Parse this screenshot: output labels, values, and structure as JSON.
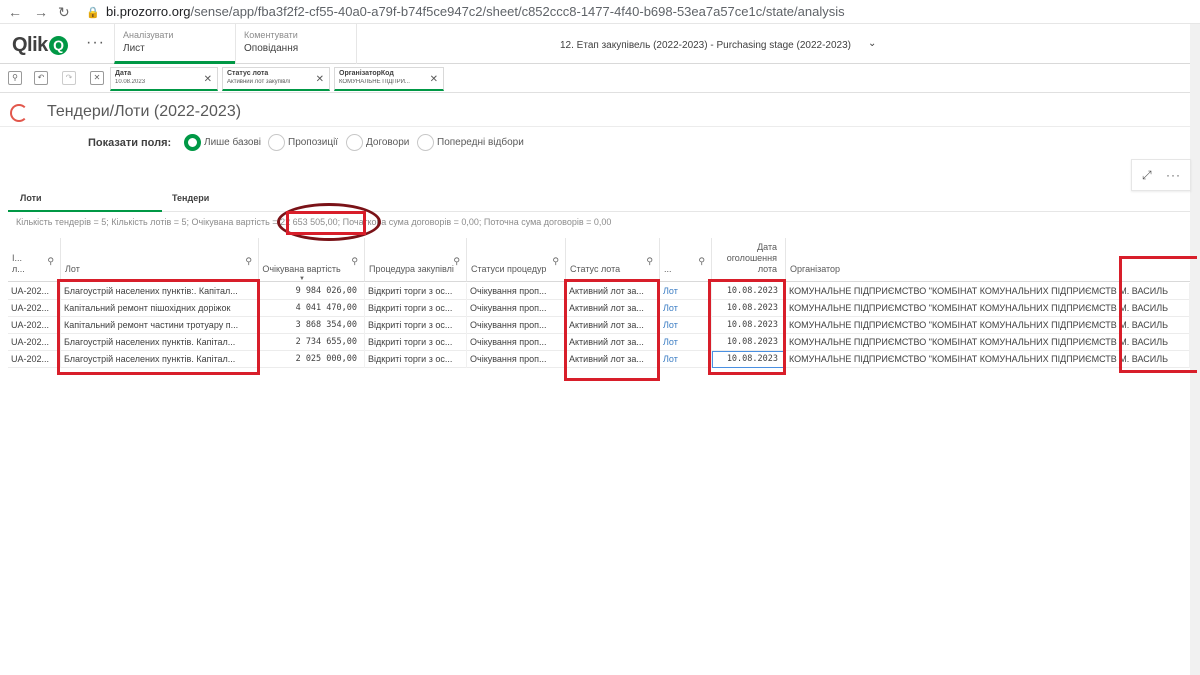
{
  "browser": {
    "url_host": "bi.prozorro.org",
    "url_rest": "/sense/app/fba3f2f2-cf55-40a0-a79f-b74f5ce947c2/sheet/c852ccc8-1477-4f40-b698-53ea7a57ce1c/state/analysis"
  },
  "header": {
    "logo": "Qlik",
    "tabs": [
      {
        "small": "Аналізувати",
        "label": "Лист"
      },
      {
        "small": "Коментувати",
        "label": "Оповідання"
      }
    ],
    "app_title": "12. Етап закупівель (2022-2023) - Purchasing stage (2022-2023)"
  },
  "selections": [
    {
      "field": "Дата",
      "value": "10.08.2023"
    },
    {
      "field": "Статус лота",
      "value": "Активний лот закупівлі"
    },
    {
      "field": "ОрганізаторКод",
      "value": "КОМУНАЛЬНЕ ПІДПРИ..."
    }
  ],
  "sheet": {
    "title": "Тендери/Лоти (2022-2023)"
  },
  "fields": {
    "label": "Показати поля:",
    "options": [
      "Лише базові",
      "Пропозиції",
      "Договори",
      "Попередні відбори"
    ],
    "selected_index": 0
  },
  "container": {
    "tabs": [
      "Лоти",
      "Тендери"
    ],
    "kpi_text": "Кількість тендерів = 5; Кількість лотів = 5; Очікувана вартість = 22 653 505,00; Початкова сума договорів = 0,00; Поточна сума договорів = 0,00"
  },
  "table": {
    "headers": [
      "I... л...",
      "Лот",
      "Очікувана вартість",
      "Процедура закупівлі",
      "Статуси процедур",
      "Статус лота",
      "...",
      "Дата оголошення лота",
      "Організатор"
    ],
    "rows": [
      [
        "UA-202...",
        "Благоустрій населених пунктів:. Капітал...",
        "9 984 026,00",
        "Відкриті торги з ос...",
        "Очікування проп...",
        "Активний лот за...",
        "Лот",
        "10.08.2023",
        "КОМУНАЛЬНЕ ПІДПРИЄМСТВО \"КОМБІНАТ КОМУНАЛЬНИХ ПІДПРИЄМСТВ М. ВАСИЛЬ"
      ],
      [
        "UA-202...",
        "Капітальний ремонт пішохідних доріжок",
        "4 041 470,00",
        "Відкриті торги з ос...",
        "Очікування проп...",
        "Активний лот за...",
        "Лот",
        "10.08.2023",
        "КОМУНАЛЬНЕ ПІДПРИЄМСТВО \"КОМБІНАТ КОМУНАЛЬНИХ ПІДПРИЄМСТВ М. ВАСИЛЬ"
      ],
      [
        "UA-202...",
        "Капітальний ремонт частини тротуару п...",
        "3 868 354,00",
        "Відкриті торги з ос...",
        "Очікування проп...",
        "Активний лот за...",
        "Лот",
        "10.08.2023",
        "КОМУНАЛЬНЕ ПІДПРИЄМСТВО \"КОМБІНАТ КОМУНАЛЬНИХ ПІДПРИЄМСТВ М. ВАСИЛЬ"
      ],
      [
        "UA-202...",
        "Благоустрій населених пунктів. Капітал...",
        "2 734 655,00",
        "Відкриті торги з ос...",
        "Очікування проп...",
        "Активний лот за...",
        "Лот",
        "10.08.2023",
        "КОМУНАЛЬНЕ ПІДПРИЄМСТВО \"КОМБІНАТ КОМУНАЛЬНИХ ПІДПРИЄМСТВ М. ВАСИЛЬ"
      ],
      [
        "UA-202...",
        "Благоустрій населених пунктів. Капітал...",
        "2 025 000,00",
        "Відкриті торги з ос...",
        "Очікування проп...",
        "Активний лот за...",
        "Лот",
        "10.08.2023",
        "КОМУНАЛЬНЕ ПІДПРИЄМСТВО \"КОМБІНАТ КОМУНАЛЬНИХ ПІДПРИЄМСТВ М. ВАСИЛЬ"
      ]
    ]
  },
  "colors": {
    "accent": "#009845",
    "annotation": "#d81e2a",
    "link": "#3b7dc4"
  }
}
